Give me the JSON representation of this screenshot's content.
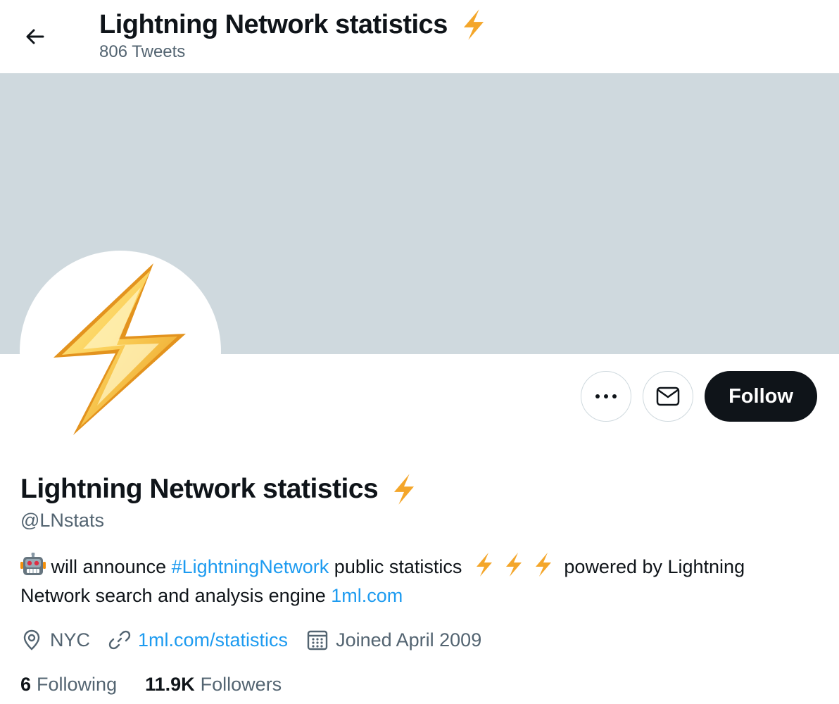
{
  "header": {
    "back_icon": "arrow-left-icon",
    "title": "Lightning Network statistics",
    "title_emoji": "lightning-bolt-emoji",
    "tweet_count": "806 Tweets"
  },
  "colors": {
    "banner": "#cfd9de",
    "link": "#1d9bf0",
    "follow_button_bg": "#0f1419",
    "secondary_text": "#536471",
    "bolt_emoji": "#f4a62a"
  },
  "actions": {
    "more_icon": "more-dots-icon",
    "message_icon": "envelope-icon",
    "follow_label": "Follow"
  },
  "profile": {
    "name": "Lightning Network statistics",
    "handle": "@LNstats",
    "bio": {
      "robot_emoji": "robot-emoji",
      "text_1": "will announce",
      "hashtag": "#LightningNetwork",
      "text_2": "public statistics",
      "text_3": "powered by Lightning Network search and analysis engine",
      "bio_link": "1ml.com"
    },
    "location": "NYC",
    "website": "1ml.com/statistics",
    "joined": "Joined April 2009",
    "following_count": "6",
    "following_label": "Following",
    "followers_count": "11.9K",
    "followers_label": "Followers"
  }
}
